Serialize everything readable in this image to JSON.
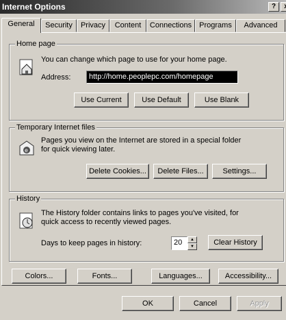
{
  "window": {
    "title": "Internet Options",
    "help_glyph": "?",
    "close_glyph": "x"
  },
  "tabs": [
    {
      "label": "General"
    },
    {
      "label": "Security"
    },
    {
      "label": "Privacy"
    },
    {
      "label": "Content"
    },
    {
      "label": "Connections"
    },
    {
      "label": "Programs"
    },
    {
      "label": "Advanced"
    }
  ],
  "home_page": {
    "title": "Home page",
    "description": "You can change which page to use for your home page.",
    "address_label": "Address:",
    "address_value": "http://home.peoplepc.com/homepage",
    "use_current": "Use Current",
    "use_default": "Use Default",
    "use_blank": "Use Blank"
  },
  "temp_files": {
    "title": "Temporary Internet files",
    "description_line1": "Pages you view on the Internet are stored in a special folder",
    "description_line2": "for quick viewing later.",
    "delete_cookies": "Delete Cookies...",
    "delete_files": "Delete Files...",
    "settings": "Settings..."
  },
  "history": {
    "title": "History",
    "description_line1": "The History folder contains links to pages you've visited, for",
    "description_line2": "quick access to recently viewed pages.",
    "days_label": "Days to keep pages in history:",
    "days_value": "20",
    "clear_history": "Clear History"
  },
  "bottom_buttons": {
    "colors": "Colors...",
    "fonts": "Fonts...",
    "languages": "Languages...",
    "accessibility": "Accessibility..."
  },
  "dialog_buttons": {
    "ok": "OK",
    "cancel": "Cancel",
    "apply": "Apply"
  },
  "colors": {
    "face": "#d4d0c8",
    "address_bg": "#000000",
    "title_gradient_start": "#2a2a2a"
  },
  "icons": [
    "home-page-icon",
    "temporary-files-icon",
    "history-icon",
    "spin-up-icon",
    "spin-down-icon"
  ]
}
